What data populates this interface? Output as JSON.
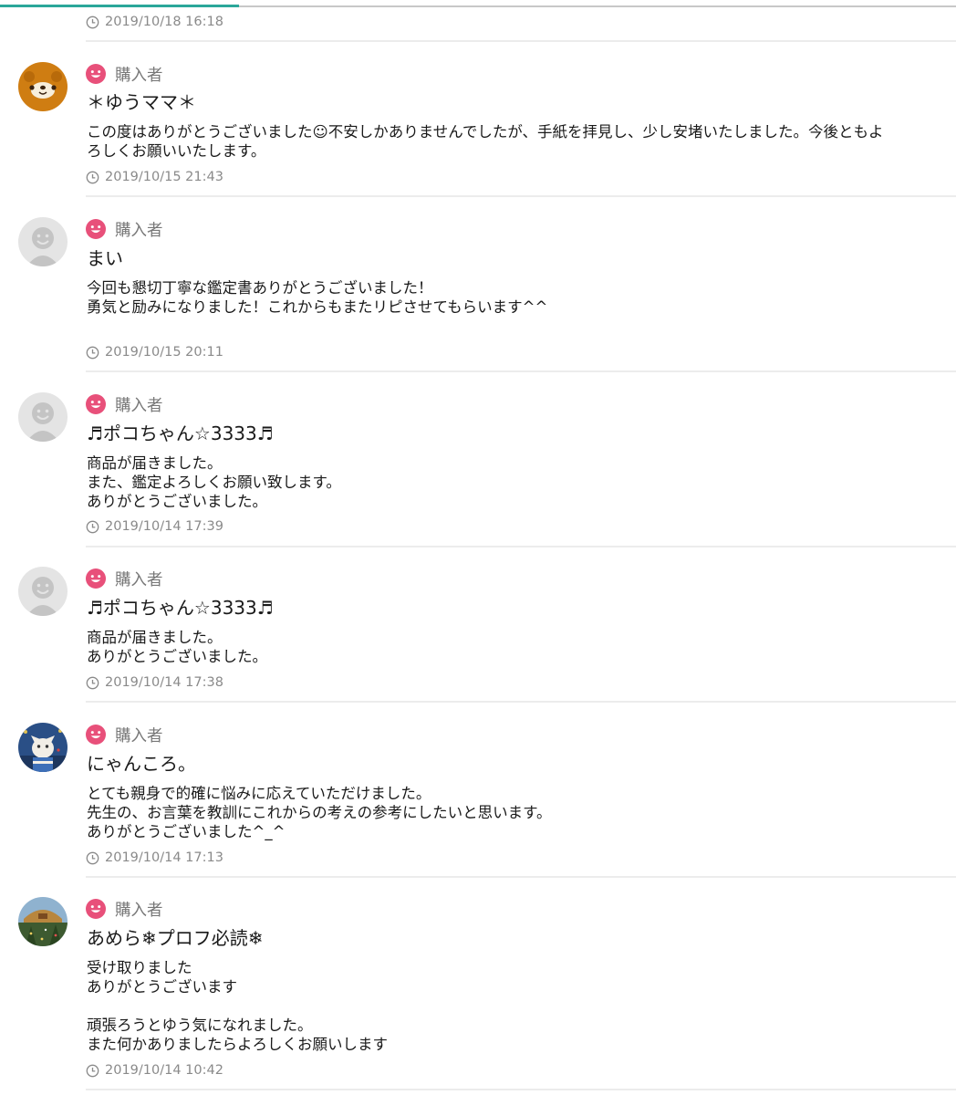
{
  "ui": {
    "accent_color": "#2ba79a",
    "buyer_badge_color": "#e8507a",
    "clock_icon": "clock-icon",
    "buyer_icon": "smiley-face-icon",
    "scroll_progress": 0.25
  },
  "first_timestamp": "2019/10/18 16:18",
  "reviews": [
    {
      "badge": "購入者",
      "name": "＊ゆうママ＊",
      "body": "この度はありがとうございました☺不安しかありませんでしたが、手紙を拝見し、少し安堵いたしました。今後ともよ\nろしくお願いいたします。",
      "timestamp": "2019/10/15 21:43",
      "avatar": "bear-avatar"
    },
    {
      "badge": "購入者",
      "name": "まい",
      "body": "今回も懇切丁寧な鑑定書ありがとうございました！\n勇気と励みになりました！これからもまたリピさせてもらいます^^",
      "timestamp": "2019/10/15 20:11",
      "avatar": "default-avatar"
    },
    {
      "badge": "購入者",
      "name": "♬ポコちゃん☆3333♬",
      "body": "商品が届きました。\nまた、鑑定よろしくお願い致します。\nありがとうございました。",
      "timestamp": "2019/10/14 17:39",
      "avatar": "default-avatar"
    },
    {
      "badge": "購入者",
      "name": "♬ポコちゃん☆3333♬",
      "body": "商品が届きました。\nありがとうございました。",
      "timestamp": "2019/10/14 17:38",
      "avatar": "default-avatar"
    },
    {
      "badge": "購入者",
      "name": "にゃんころ。",
      "body": "とても親身で的確に悩みに応えていただけました。\n先生の、お言葉を教訓にこれからの考えの参考にしたいと思います。\nありがとうございました^_^",
      "timestamp": "2019/10/14 17:13",
      "avatar": "cat-photo-avatar"
    },
    {
      "badge": "購入者",
      "name": "あめら❄プロフ必読❄",
      "body": "受け取りました\nありがとうございます\n\n頑張ろうとゆう気になれました。\nまた何かありましたらよろしくお願いします",
      "timestamp": "2019/10/14 10:42",
      "avatar": "scenery-photo-avatar"
    }
  ]
}
